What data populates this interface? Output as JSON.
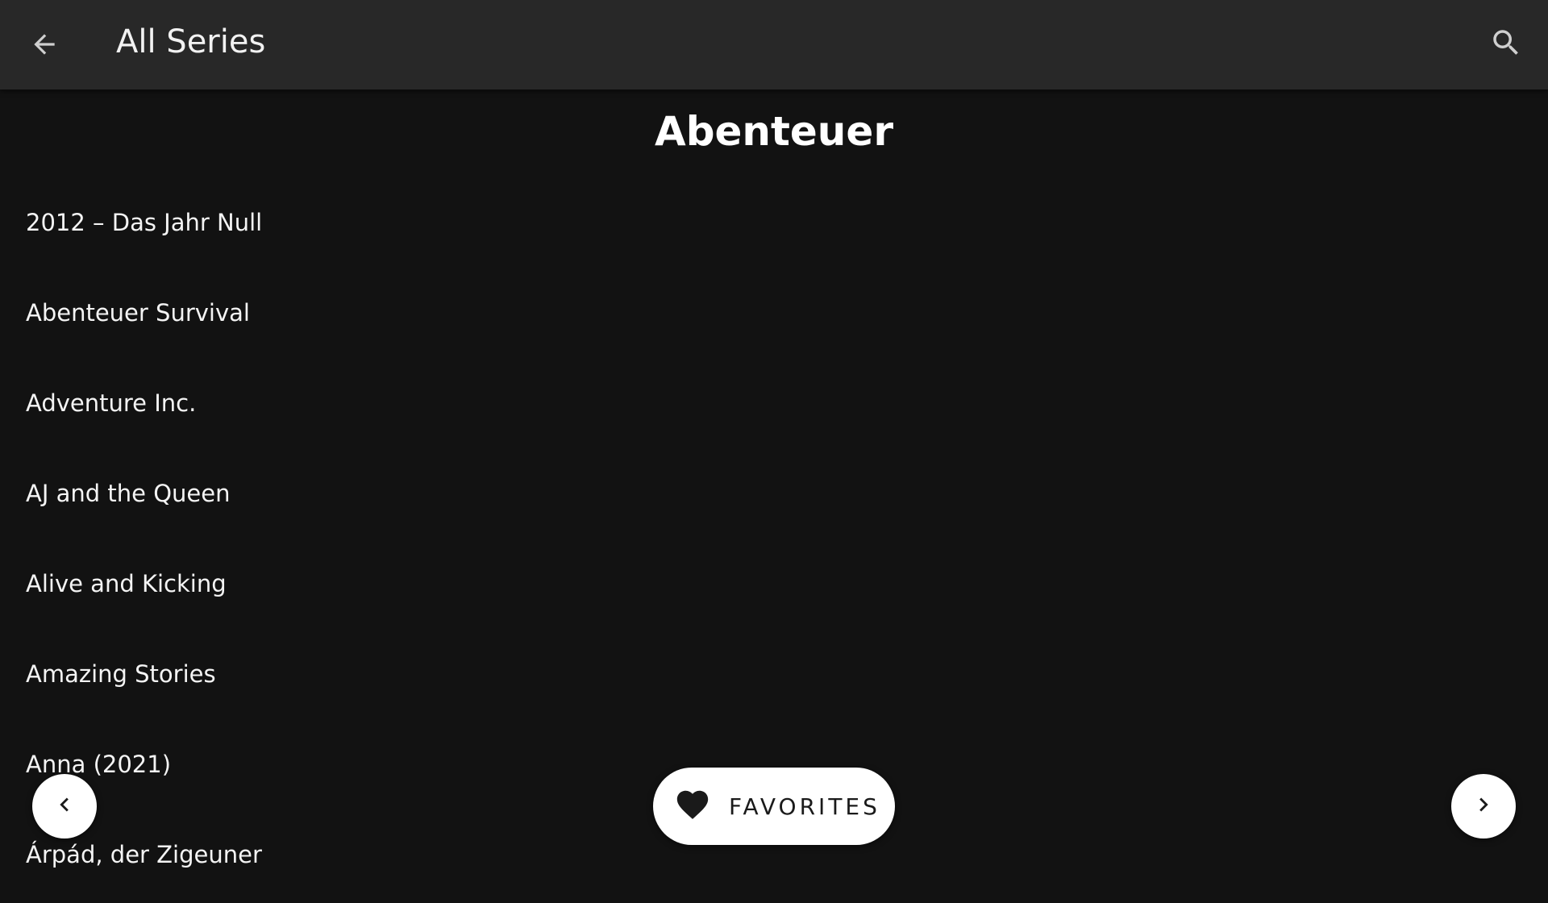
{
  "header": {
    "title": "All Series",
    "back_icon": "arrow-left-icon",
    "search_icon": "search-icon"
  },
  "main": {
    "heading": "Abenteuer",
    "series": [
      "2012 – Das Jahr Null",
      "Abenteuer Survival",
      "Adventure Inc.",
      "AJ and the Queen",
      "Alive and Kicking",
      "Amazing Stories",
      "Anna (2021)",
      "Árpád, der Zigeuner"
    ]
  },
  "controls": {
    "favorites_label": "FAVORITES",
    "favorites_icon": "heart-icon",
    "prev_icon": "chevron-left-icon",
    "next_icon": "chevron-right-icon"
  },
  "colors": {
    "background": "#121212",
    "app_bar": "#282828",
    "text": "#ffffff",
    "button_background": "#ffffff",
    "button_foreground": "#1a1a1a"
  }
}
